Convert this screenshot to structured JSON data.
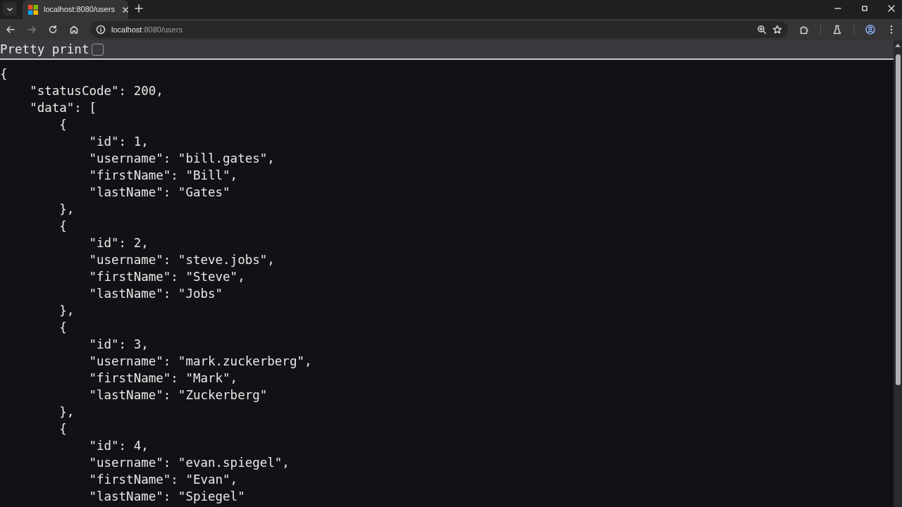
{
  "tab": {
    "title": "localhost:8080/users",
    "selected": true
  },
  "address_bar": {
    "host": "localhost",
    "path": ":8080/users"
  },
  "navigation": {
    "back_disabled": false,
    "forward_disabled": true
  },
  "pretty_print": {
    "label": "Pretty print",
    "checked": false
  },
  "json_lines": [
    "{",
    "    \"statusCode\": 200,",
    "    \"data\": [",
    "        {",
    "            \"id\": 1,",
    "            \"username\": \"bill.gates\",",
    "            \"firstName\": \"Bill\",",
    "            \"lastName\": \"Gates\"",
    "        },",
    "        {",
    "            \"id\": 2,",
    "            \"username\": \"steve.jobs\",",
    "            \"firstName\": \"Steve\",",
    "            \"lastName\": \"Jobs\"",
    "        },",
    "        {",
    "            \"id\": 3,",
    "            \"username\": \"mark.zuckerberg\",",
    "            \"firstName\": \"Mark\",",
    "            \"lastName\": \"Zuckerberg\"",
    "        },",
    "        {",
    "            \"id\": 4,",
    "            \"username\": \"evan.spiegel\",",
    "            \"firstName\": \"Evan\",",
    "            \"lastName\": \"Spiegel\""
  ]
}
